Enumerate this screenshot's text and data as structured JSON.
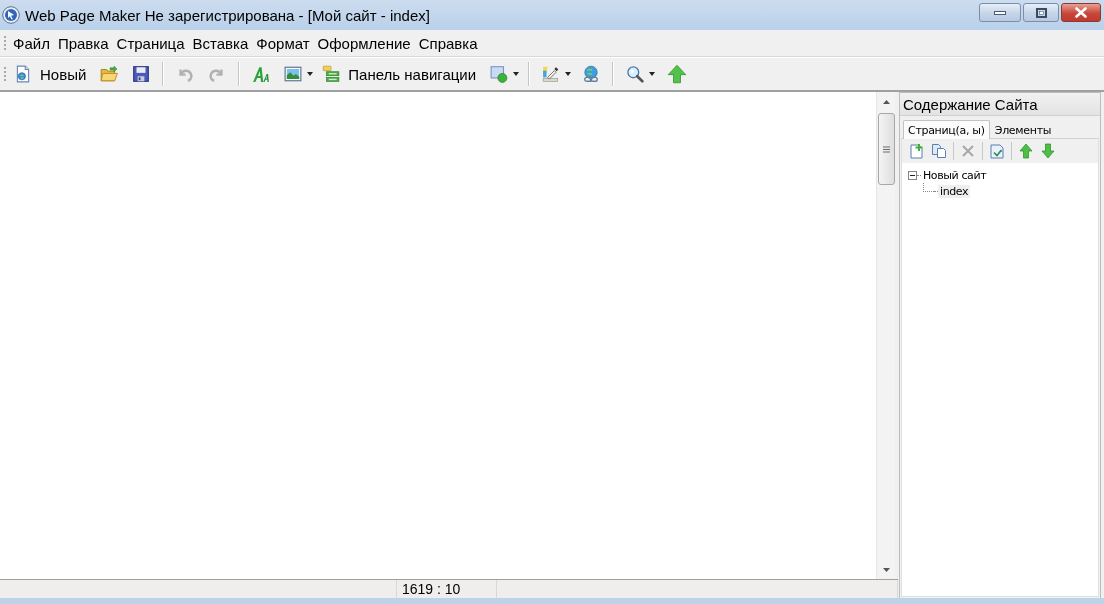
{
  "window": {
    "title": "Web Page Maker Не зарегистрирована - [Мой сайт - index]"
  },
  "menu": [
    "Файл",
    "Правка",
    "Страница",
    "Вставка",
    "Формат",
    "Оформление",
    "Справка"
  ],
  "toolbar": [
    [
      {
        "kind": "new",
        "label": "Новый",
        "disabled": false,
        "dropdown": false
      },
      {
        "kind": "open",
        "disabled": false,
        "dropdown": false
      },
      {
        "kind": "save",
        "disabled": false,
        "dropdown": false
      }
    ],
    [
      {
        "kind": "undo",
        "disabled": true,
        "dropdown": false
      },
      {
        "kind": "redo",
        "disabled": true,
        "dropdown": false
      }
    ],
    [
      {
        "kind": "text",
        "disabled": false,
        "dropdown": false
      },
      {
        "kind": "image",
        "disabled": false,
        "dropdown": true
      },
      {
        "kind": "navigation",
        "label": "Панель навигации",
        "disabled": false,
        "dropdown": false
      },
      {
        "kind": "shape",
        "disabled": false,
        "dropdown": true
      }
    ],
    [
      {
        "kind": "color",
        "disabled": false,
        "dropdown": true
      },
      {
        "kind": "link",
        "disabled": false,
        "dropdown": false
      }
    ],
    [
      {
        "kind": "zoom",
        "disabled": false,
        "dropdown": true
      },
      {
        "kind": "publish",
        "disabled": false,
        "dropdown": false
      }
    ]
  ],
  "site_panel": {
    "title": "Содержание Сайта",
    "tabs": [
      {
        "label": "Страниц(а, ы)",
        "selected": true
      },
      {
        "label": "Элементы",
        "selected": false
      }
    ],
    "toolbar": [
      {
        "kind": "add",
        "disabled": false
      },
      {
        "kind": "copy",
        "disabled": false
      },
      {
        "kind": "delete",
        "disabled": true
      },
      {
        "kind": "refresh",
        "disabled": false
      },
      {
        "kind": "up",
        "disabled": false
      },
      {
        "kind": "down",
        "disabled": false
      }
    ],
    "tree": [
      {
        "label": "Новый сайт",
        "expanded": true,
        "selected": false,
        "children": [
          {
            "label": "index",
            "selected": true
          }
        ]
      }
    ]
  },
  "status_bar": {
    "position": "1619 : 10"
  }
}
